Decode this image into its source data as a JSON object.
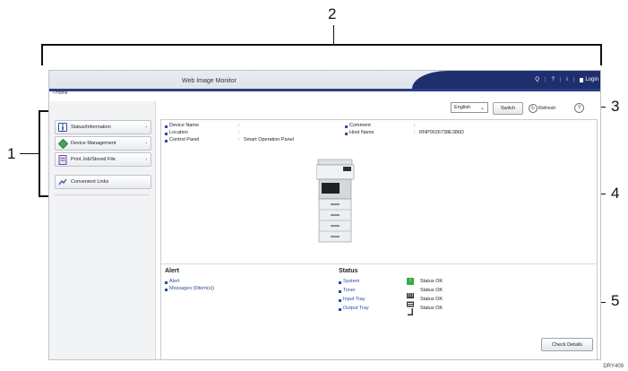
{
  "callouts": [
    "1",
    "2",
    "3",
    "4",
    "5"
  ],
  "figure_code": "DRY409",
  "header": {
    "app_title": "Web Image Monitor",
    "links": [
      "Q",
      "?",
      "i",
      "Login"
    ]
  },
  "breadcrumb": "• Home",
  "toolbar": {
    "language_value": "English",
    "switch_label": "Switch",
    "refresh_label": "Refresh",
    "help_glyph": "?"
  },
  "sidebar": {
    "items": [
      {
        "label": "Status/Information",
        "icon": "info-icon",
        "arrow": "›"
      },
      {
        "label": "Device Management",
        "icon": "device-management-icon",
        "arrow": "›"
      },
      {
        "label": "Print Job/Stored File",
        "icon": "print-job-icon",
        "arrow": "›"
      },
      {
        "label": "Convenient Links",
        "icon": "convenient-links-icon"
      }
    ]
  },
  "device": {
    "rows": [
      {
        "label": "Device Name",
        "sep": ":",
        "value": ""
      },
      {
        "label": "Location",
        "sep": ":",
        "value": ""
      },
      {
        "label": "Control Panel",
        "sep": ":",
        "value": "Smart Operation Panel"
      }
    ],
    "rows_right": [
      {
        "label": "Comment",
        "sep": ":",
        "value": ""
      },
      {
        "label": "Host Name",
        "sep": ":",
        "value": "RNP0026738E386D"
      }
    ]
  },
  "alert": {
    "heading": "Alert",
    "items": [
      "Alert",
      "Messages (0item(s))"
    ]
  },
  "status": {
    "heading": "Status",
    "items": [
      {
        "label": "System",
        "value": "Status OK",
        "icon": "system-ok-icon"
      },
      {
        "label": "Toner",
        "value": "Status OK",
        "icon": "toner-icon"
      },
      {
        "label": "Input Tray",
        "value": "Status OK",
        "icon": "input-tray-icon"
      },
      {
        "label": "Output Tray",
        "value": "Status OK",
        "icon": "output-tray-icon"
      }
    ],
    "check_details_label": "Check Details"
  },
  "colors": {
    "accent": "#2b3f86",
    "link": "#2b4aa8",
    "ok_green": "#3aa845"
  }
}
